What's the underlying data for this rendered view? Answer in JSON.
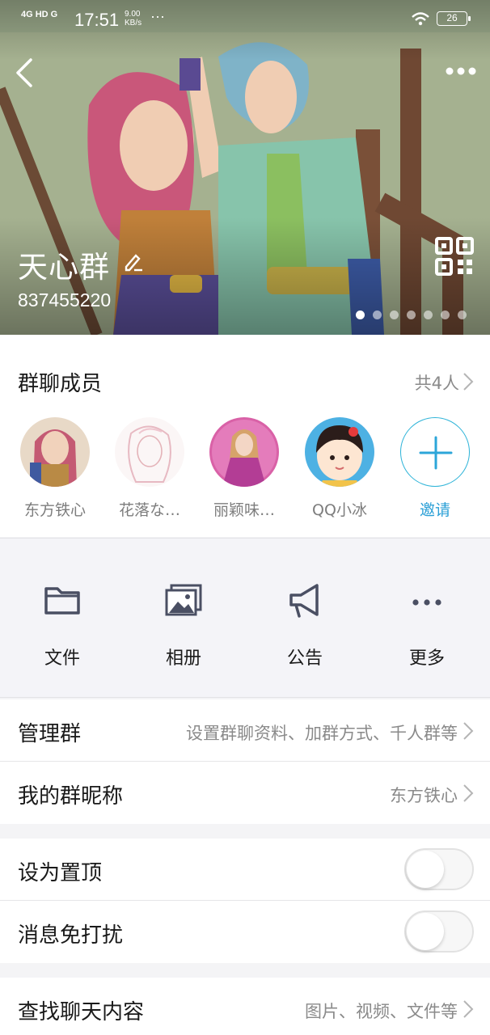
{
  "status_bar": {
    "network": "4G HD  G",
    "time": "17:51",
    "speed_value": "9.00",
    "speed_unit": "KB/s",
    "more": "···",
    "battery": "26"
  },
  "header": {
    "group_name": "天心群",
    "group_id": "837455220",
    "page_indicator": {
      "count": 7,
      "active_index": 0
    }
  },
  "members": {
    "title": "群聊成员",
    "count_label": "共4人",
    "items": [
      {
        "name": "东方铁心"
      },
      {
        "name": "花落な…"
      },
      {
        "name": "丽颖味…"
      },
      {
        "name": "QQ小冰"
      }
    ],
    "invite_label": "邀请"
  },
  "actions": [
    {
      "label": "文件",
      "icon": "folder-icon"
    },
    {
      "label": "相册",
      "icon": "album-icon"
    },
    {
      "label": "公告",
      "icon": "megaphone-icon"
    },
    {
      "label": "更多",
      "icon": "more-dots-icon"
    }
  ],
  "settings": {
    "manage": {
      "label": "管理群",
      "value": "设置群聊资料、加群方式、千人群等"
    },
    "nickname": {
      "label": "我的群昵称",
      "value": "东方铁心"
    },
    "pin": {
      "label": "设为置顶",
      "on": false
    },
    "mute": {
      "label": "消息免打扰",
      "on": false
    },
    "search": {
      "label": "查找聊天内容",
      "value": "图片、视频、文件等"
    }
  },
  "colors": {
    "accent": "#2ca6d9",
    "icon_dark": "#4a4f63",
    "muted_text": "#8a8a8a"
  }
}
